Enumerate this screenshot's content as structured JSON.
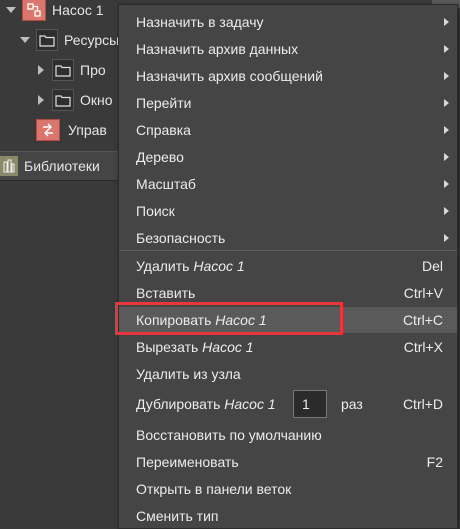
{
  "tree": {
    "root_label": "Насос 1",
    "resources_label": "Ресурсы",
    "child1_label": "Про",
    "child2_label": "Окно",
    "control_label": "Управ",
    "libraries_label": "Библиотеки"
  },
  "menu": {
    "items": [
      {
        "label": "Назначить в задачу",
        "submenu": true
      },
      {
        "label": "Назначить архив данных",
        "submenu": true
      },
      {
        "label": "Назначить архив сообщений",
        "submenu": true
      },
      {
        "label": "Перейти",
        "submenu": true
      },
      {
        "label": "Справка",
        "submenu": true
      },
      {
        "label": "Дерево",
        "submenu": true
      },
      {
        "label": "Масштаб",
        "submenu": true
      },
      {
        "label": "Поиск",
        "submenu": true
      },
      {
        "label": "Безопасность",
        "submenu": true
      }
    ],
    "delete": {
      "label": "Удалить",
      "target": "Насос 1",
      "shortcut": "Del"
    },
    "paste": {
      "label": "Вставить",
      "shortcut": "Ctrl+V"
    },
    "copy": {
      "label": "Копировать",
      "target": "Насос 1",
      "shortcut": "Ctrl+C"
    },
    "cut": {
      "label": "Вырезать",
      "target": "Насос 1",
      "shortcut": "Ctrl+X"
    },
    "remove_from_node": {
      "label": "Удалить из узла"
    },
    "duplicate": {
      "label": "Дублировать",
      "target": "Насос 1",
      "count": "1",
      "times": "раз",
      "shortcut": "Ctrl+D"
    },
    "restore_default": {
      "label": "Восстановить по умолчанию"
    },
    "rename": {
      "label": "Переименовать",
      "shortcut": "F2"
    },
    "open_in_branch_panel": {
      "label": "Открыть в панели веток"
    },
    "change_type": {
      "label": "Сменить тип"
    }
  },
  "colors": {
    "highlight_frame": "#e8363d",
    "menu_bg": "#454545",
    "hover_bg": "#5a5a5a"
  }
}
